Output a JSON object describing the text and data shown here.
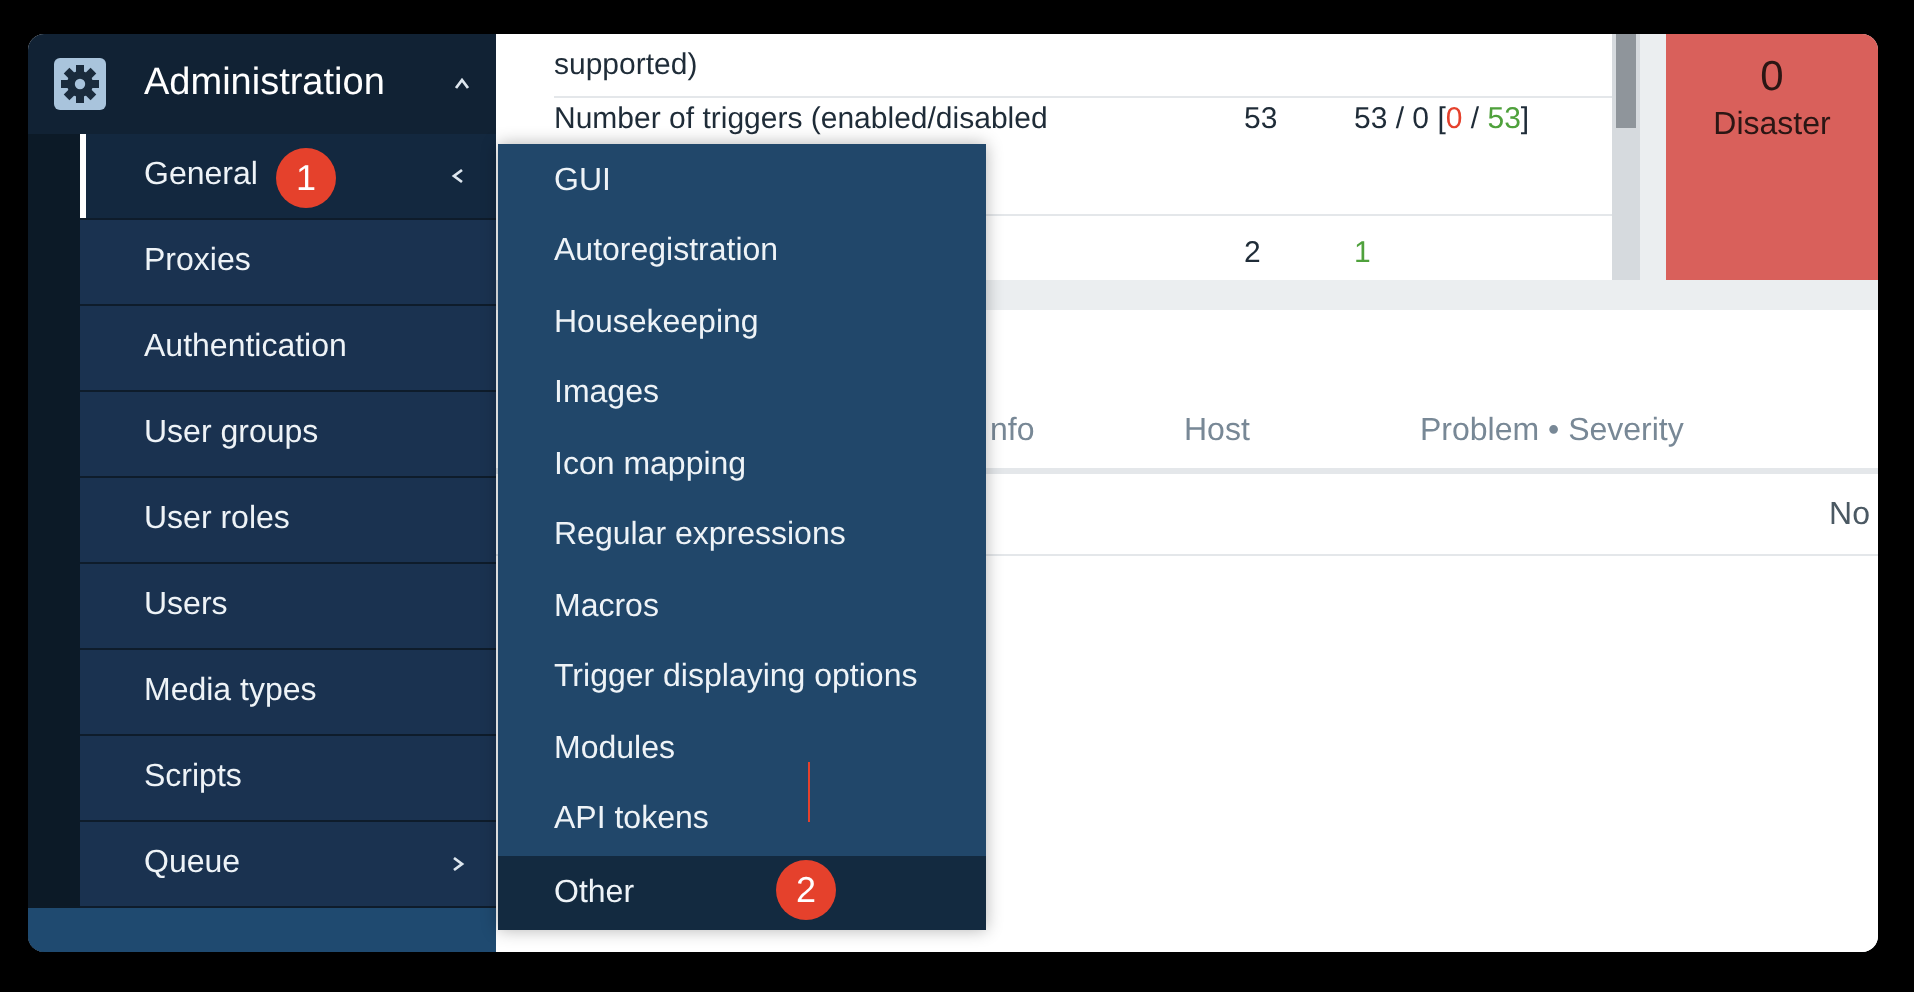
{
  "sidebar": {
    "section": {
      "title": "Administration",
      "expanded": true
    },
    "items": [
      {
        "label": "General",
        "kind": "submenu",
        "expanded": true,
        "selected": true,
        "badge": "1"
      },
      {
        "label": "Proxies",
        "kind": "link",
        "selected": false
      },
      {
        "label": "Authentication",
        "kind": "link",
        "selected": false
      },
      {
        "label": "User groups",
        "kind": "link",
        "selected": false
      },
      {
        "label": "User roles",
        "kind": "link",
        "selected": false
      },
      {
        "label": "Users",
        "kind": "link",
        "selected": false
      },
      {
        "label": "Media types",
        "kind": "link",
        "selected": false
      },
      {
        "label": "Scripts",
        "kind": "link",
        "selected": false
      },
      {
        "label": "Queue",
        "kind": "submenu",
        "expanded": false,
        "selected": false
      }
    ]
  },
  "submenu": {
    "items": [
      {
        "label": "GUI",
        "selected": false
      },
      {
        "label": "Autoregistration",
        "selected": false
      },
      {
        "label": "Housekeeping",
        "selected": false
      },
      {
        "label": "Images",
        "selected": false
      },
      {
        "label": "Icon mapping",
        "selected": false
      },
      {
        "label": "Regular expressions",
        "selected": false
      },
      {
        "label": "Macros",
        "selected": false
      },
      {
        "label": "Trigger displaying options",
        "selected": false
      },
      {
        "label": "Modules",
        "selected": false
      },
      {
        "label": "API tokens",
        "selected": false
      },
      {
        "label": "Other",
        "selected": true,
        "badge": "2"
      }
    ]
  },
  "overview_table": {
    "rows": [
      {
        "cells": [
          [
            {
              "text": "supported)"
            }
          ]
        ]
      },
      {
        "cells": [
          [
            {
              "text": "Number of triggers (enabled/disabled"
            }
          ],
          [
            {
              "text": "53"
            }
          ],
          [
            {
              "text": "53 / 0 ["
            },
            {
              "text": "0",
              "color": "#e5412c"
            },
            {
              "text": " / "
            },
            {
              "text": "53",
              "color": "#4fa13c"
            },
            {
              "text": "]"
            }
          ]
        ]
      },
      {
        "cells": [
          [],
          [
            {
              "text": "2"
            }
          ],
          [
            {
              "text": "1",
              "color": "#4fa13c"
            }
          ]
        ]
      }
    ]
  },
  "severity": {
    "count": "0",
    "label": "Disaster",
    "color": "#d9605b"
  },
  "problems": {
    "columns": [
      "nfo",
      "Host",
      "Problem • Severity"
    ],
    "message": "No"
  }
}
